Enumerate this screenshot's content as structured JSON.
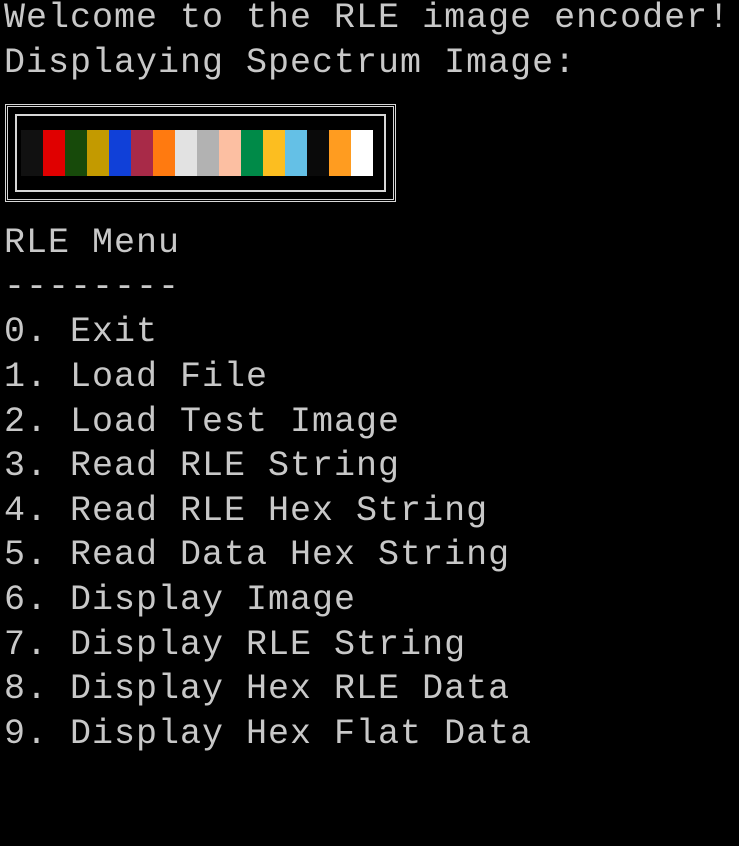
{
  "terminal": {
    "welcome": "Welcome to the RLE image encoder!",
    "spectrum_heading": "Displaying Spectrum Image:",
    "menu_title": "RLE Menu",
    "menu_divider": "--------",
    "menu_items": [
      "0. Exit",
      "1. Load File",
      "2. Load Test Image",
      "3. Read RLE String",
      "4. Read RLE Hex String",
      "5. Read Data Hex String",
      "6. Display Image",
      "7. Display RLE String",
      "8. Display Hex RLE Data",
      "9. Display Hex Flat Data"
    ]
  },
  "spectrum": {
    "colors": [
      "#111111",
      "#e00000",
      "#174a0a",
      "#c39a00",
      "#1040d8",
      "#a82a48",
      "#ff7a10",
      "#e2e2e2",
      "#b2b2b2",
      "#fcbfa2",
      "#008a48",
      "#fcbe20",
      "#64c0e6",
      "#0a0a0a",
      "#ff9c20",
      "#ffffff"
    ]
  }
}
